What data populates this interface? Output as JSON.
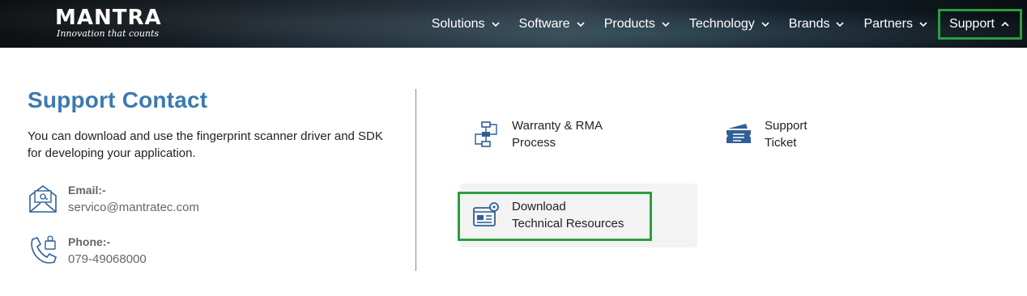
{
  "header": {
    "logo_text": "MANTRA",
    "logo_tagline": "Innovation that counts",
    "nav": [
      {
        "label": "Solutions"
      },
      {
        "label": "Software"
      },
      {
        "label": "Products"
      },
      {
        "label": "Technology"
      },
      {
        "label": "Brands"
      },
      {
        "label": "Partners"
      },
      {
        "label": "Support"
      }
    ]
  },
  "support": {
    "title": "Support Contact",
    "description": "You can download and use the fingerprint scanner driver and SDK for developing your application.",
    "email_label": "Email:-",
    "email_value": "servico@mantratec.com",
    "phone_label": "Phone:-",
    "phone_value": "079-49068000"
  },
  "menu": {
    "warranty_line1": "Warranty & RMA",
    "warranty_line2": "Process",
    "ticket_line1": "Support",
    "ticket_line2": "Ticket",
    "download_line1": "Download",
    "download_line2": "Technical Resources"
  },
  "colors": {
    "accent": "#3b7ab0",
    "highlight": "#2a9e3e",
    "icon": "#2f5f96"
  }
}
